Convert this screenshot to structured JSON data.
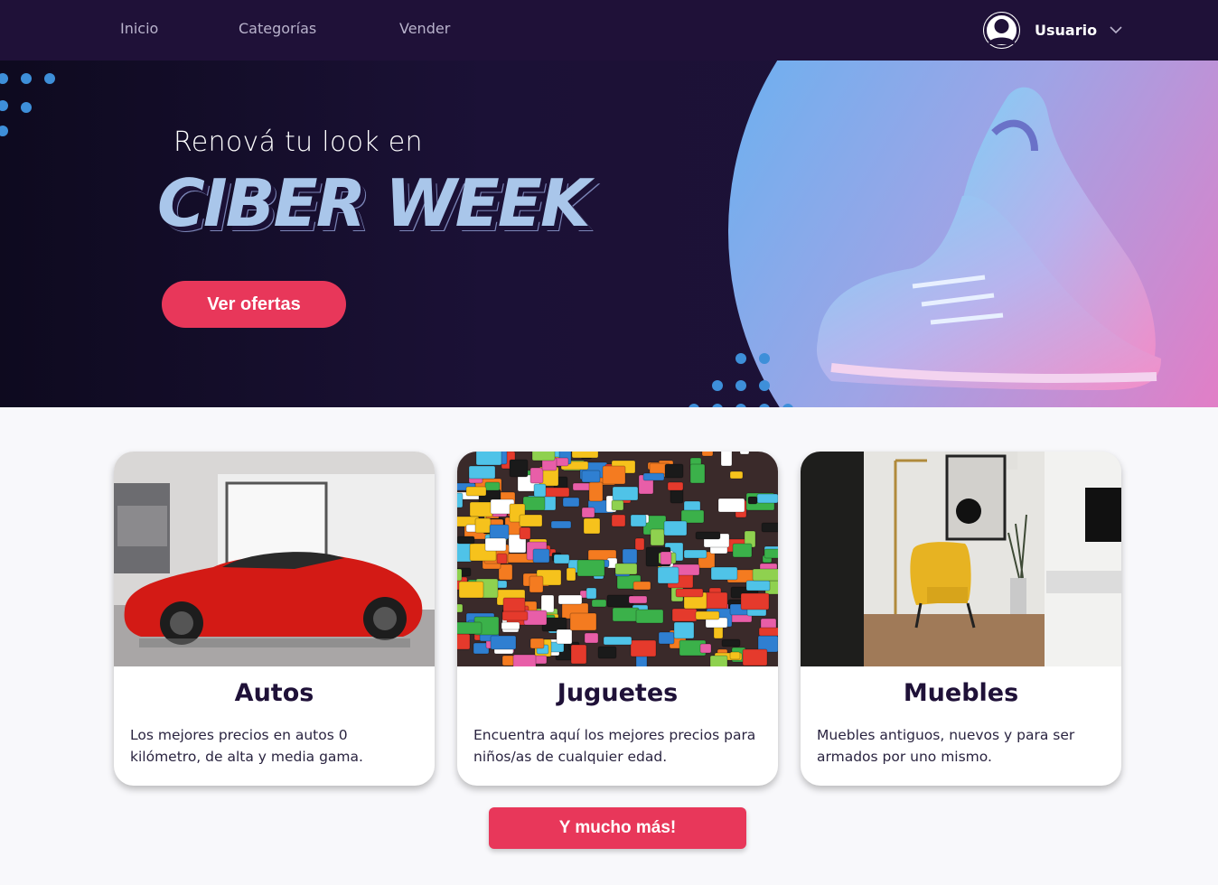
{
  "nav": {
    "items": [
      "Inicio",
      "Categorías",
      "Vender"
    ],
    "user_name": "Usuario",
    "icons": {
      "avatar": "user-avatar-icon",
      "dropdown": "chevron-down-icon"
    }
  },
  "hero": {
    "subtitle": "Renová tu look en",
    "title": "CIBER WEEK",
    "button_label": "Ver ofertas"
  },
  "categories": [
    {
      "title": "Autos",
      "description": "Los mejores precios en autos 0 kilómetro, de alta y media gama."
    },
    {
      "title": "Juguetes",
      "description": "Encuentra aquí los mejores precios para niños/as de cualquier edad."
    },
    {
      "title": "Muebles",
      "description": "Muebles antiguos, nuevos y para ser armados por uno mismo."
    }
  ],
  "more_button_label": "Y mucho más!",
  "colors": {
    "nav_bg": "#1f1138",
    "accent": "#e8375a",
    "hero_title": "#a9c6ea",
    "card_title": "#1f1138"
  }
}
